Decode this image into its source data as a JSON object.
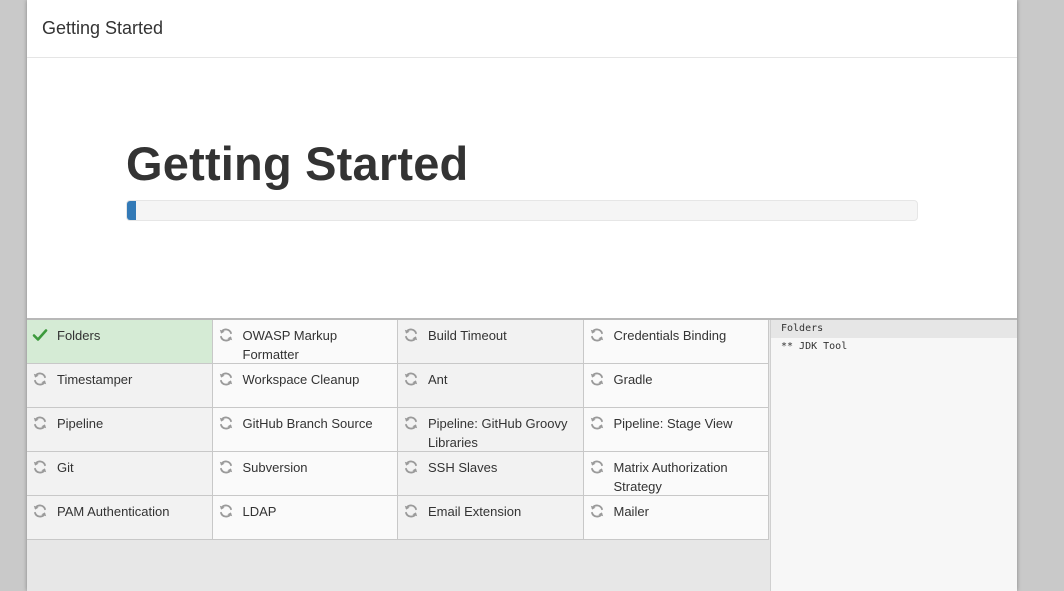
{
  "dialog": {
    "title": "Getting Started"
  },
  "hero": {
    "title": "Getting Started",
    "progress_percent": 1.2
  },
  "colors": {
    "accent": "#337ab7",
    "done_bg": "#d5ebd5",
    "check": "#3c9a3c"
  },
  "plugins": [
    {
      "label": "Folders",
      "status": "done"
    },
    {
      "label": "OWASP Markup Formatter",
      "status": "pending"
    },
    {
      "label": "Build Timeout",
      "status": "pending"
    },
    {
      "label": "Credentials Binding",
      "status": "pending"
    },
    {
      "label": "Timestamper",
      "status": "pending"
    },
    {
      "label": "Workspace Cleanup",
      "status": "pending"
    },
    {
      "label": "Ant",
      "status": "pending"
    },
    {
      "label": "Gradle",
      "status": "pending"
    },
    {
      "label": "Pipeline",
      "status": "pending"
    },
    {
      "label": "GitHub Branch Source",
      "status": "pending"
    },
    {
      "label": "Pipeline: GitHub Groovy Libraries",
      "status": "pending"
    },
    {
      "label": "Pipeline: Stage View",
      "status": "pending"
    },
    {
      "label": "Git",
      "status": "pending"
    },
    {
      "label": "Subversion",
      "status": "pending"
    },
    {
      "label": "SSH Slaves",
      "status": "pending"
    },
    {
      "label": "Matrix Authorization Strategy",
      "status": "pending"
    },
    {
      "label": "PAM Authentication",
      "status": "pending"
    },
    {
      "label": "LDAP",
      "status": "pending"
    },
    {
      "label": "Email Extension",
      "status": "pending"
    },
    {
      "label": "Mailer",
      "status": "pending"
    }
  ],
  "icons": {
    "done": "check-icon",
    "pending": "refresh-icon"
  },
  "log": [
    "Folders",
    "** JDK Tool"
  ]
}
